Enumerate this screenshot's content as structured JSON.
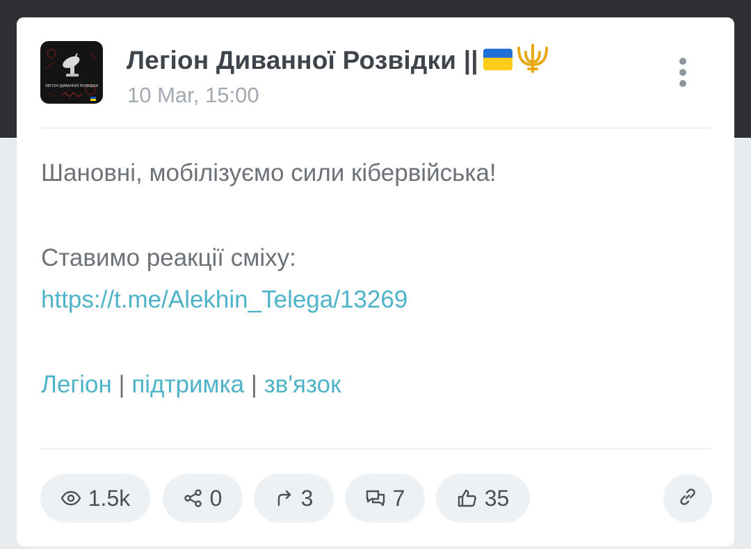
{
  "post": {
    "channel_name": "Легіон Диванної Розвідки ||",
    "channel_emoji": [
      "ukraine-flag",
      "trident"
    ],
    "date": "10 Mar, 15:00",
    "avatar_caption": "ЛЕГІОН ДИВАННОЇ РОЗВІДКИ"
  },
  "body": {
    "line1": "Шановні, мобілізуємо сили кібервійська!",
    "line2": "Ставимо реакції сміху:",
    "link": "https://t.me/Alekhin_Telega/13269",
    "footer_links": [
      "Легіон",
      "підтримка",
      "зв'язок"
    ],
    "footer_separator": "|"
  },
  "stats": {
    "views": "1.5k",
    "shares": "0",
    "forwards": "3",
    "comments": "7",
    "likes": "35"
  },
  "colors": {
    "accent_link": "#4eb3c8",
    "header_bg": "#2e3033",
    "pill_bg": "#eef1f4"
  },
  "icons": [
    "eye-icon",
    "share-icon",
    "forward-icon",
    "comments-icon",
    "thumbs-up-icon",
    "link-icon",
    "more-vertical-icon"
  ]
}
